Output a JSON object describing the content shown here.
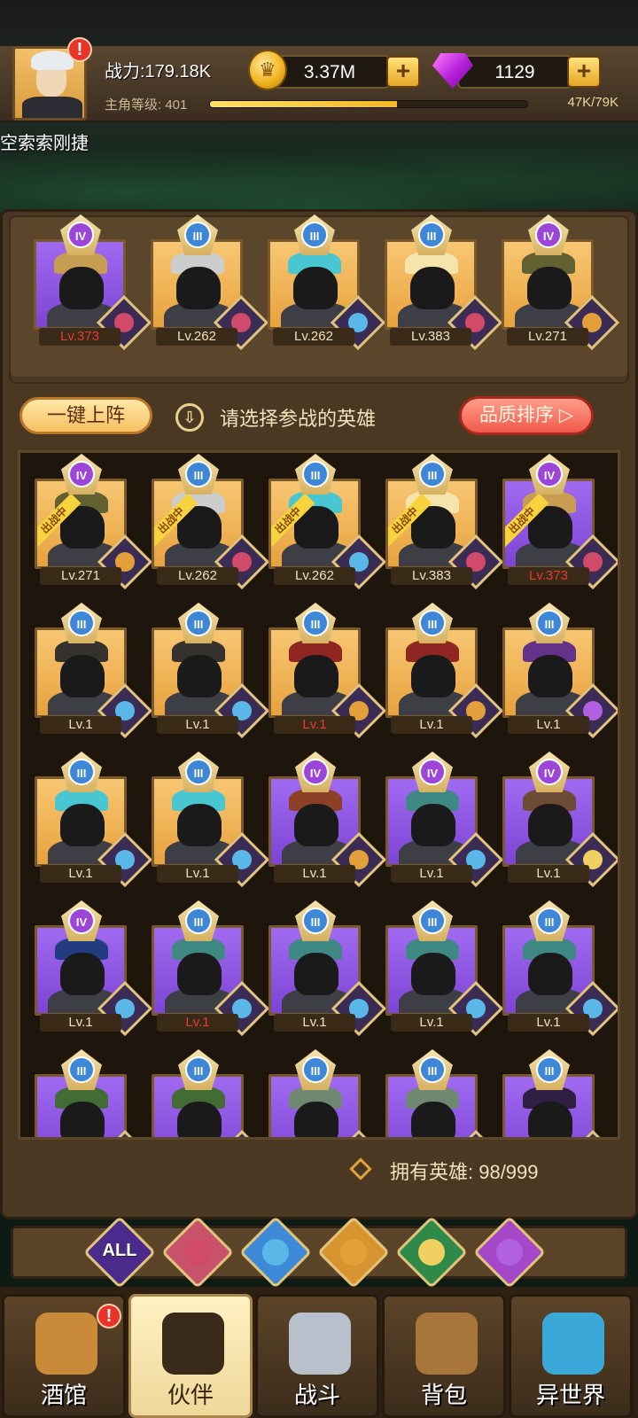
{
  "player": {
    "power": "战力:179.18K",
    "level_label": "主角等级: 401",
    "xp_text": "47K/79K",
    "xp_fraction": 0.59,
    "name": "空索索刚捷",
    "alert_mark": "!"
  },
  "resources": {
    "gold": "3.37M",
    "gems": "1129",
    "plus": "+"
  },
  "team": [
    {
      "rank": "IV",
      "level": "Lv.373",
      "bg": "purple",
      "faction": "crown",
      "level_red": true,
      "acc": "#c9a04a"
    },
    {
      "rank": "III",
      "level": "Lv.262",
      "bg": "gold",
      "faction": "crown",
      "level_red": false,
      "acc": "#c9cdd3"
    },
    {
      "rank": "III",
      "level": "Lv.262",
      "bg": "gold",
      "faction": "elf",
      "level_red": false,
      "acc": "#3ec6d8"
    },
    {
      "rank": "III",
      "level": "Lv.383",
      "bg": "gold",
      "faction": "crown",
      "level_red": false,
      "acc": "#f4e6b0"
    },
    {
      "rank": "IV",
      "level": "Lv.271",
      "bg": "gold",
      "faction": "beast",
      "level_red": false,
      "acc": "#5b5b2e"
    }
  ],
  "actions": {
    "auto_deploy": "一键上阵",
    "hint": "请选择参战的英雄",
    "sort": "品质排序 ▷",
    "download": "⇩"
  },
  "deploy_tag": "出战中",
  "roster": [
    {
      "rank": "IV",
      "level": "Lv.271",
      "bg": "gold",
      "faction": "beast",
      "level_red": false,
      "deployed": true,
      "acc": "#5b5b2e"
    },
    {
      "rank": "III",
      "level": "Lv.262",
      "bg": "gold",
      "faction": "crown",
      "level_red": false,
      "deployed": true,
      "acc": "#c9cdd3"
    },
    {
      "rank": "III",
      "level": "Lv.262",
      "bg": "gold",
      "faction": "elf",
      "level_red": false,
      "deployed": true,
      "acc": "#3ec6d8"
    },
    {
      "rank": "III",
      "level": "Lv.383",
      "bg": "gold",
      "faction": "crown",
      "level_red": false,
      "deployed": true,
      "acc": "#f4e6b0"
    },
    {
      "rank": "IV",
      "level": "Lv.373",
      "bg": "purple",
      "faction": "crown",
      "level_red": true,
      "deployed": true,
      "acc": "#c9a04a"
    },
    {
      "rank": "III",
      "level": "Lv.1",
      "bg": "gold",
      "faction": "elf",
      "level_red": false,
      "deployed": false,
      "acc": "#2a2a2a"
    },
    {
      "rank": "III",
      "level": "Lv.1",
      "bg": "gold",
      "faction": "elf",
      "level_red": false,
      "deployed": false,
      "acc": "#2a2a2a"
    },
    {
      "rank": "III",
      "level": "Lv.1",
      "bg": "gold",
      "faction": "beast",
      "level_red": true,
      "deployed": false,
      "acc": "#8a1e1e"
    },
    {
      "rank": "III",
      "level": "Lv.1",
      "bg": "gold",
      "faction": "beast",
      "level_red": false,
      "deployed": false,
      "acc": "#8a1e1e"
    },
    {
      "rank": "III",
      "level": "Lv.1",
      "bg": "gold",
      "faction": "demon",
      "level_red": false,
      "deployed": false,
      "acc": "#5c2a8a"
    },
    {
      "rank": "III",
      "level": "Lv.1",
      "bg": "gold",
      "faction": "elf",
      "level_red": false,
      "deployed": false,
      "acc": "#3ec6d8"
    },
    {
      "rank": "III",
      "level": "Lv.1",
      "bg": "gold",
      "faction": "elf",
      "level_red": false,
      "deployed": false,
      "acc": "#3ec6d8"
    },
    {
      "rank": "IV",
      "level": "Lv.1",
      "bg": "purple",
      "faction": "beast",
      "level_red": false,
      "deployed": false,
      "acc": "#8a3e1c"
    },
    {
      "rank": "IV",
      "level": "Lv.1",
      "bg": "purple",
      "faction": "elf",
      "level_red": false,
      "deployed": false,
      "acc": "#3a8a7e"
    },
    {
      "rank": "IV",
      "level": "Lv.1",
      "bg": "purple",
      "faction": "nature",
      "level_red": false,
      "deployed": false,
      "acc": "#6b4a2a"
    },
    {
      "rank": "IV",
      "level": "Lv.1",
      "bg": "purple",
      "faction": "elf",
      "level_red": false,
      "deployed": false,
      "acc": "#1c3a7a"
    },
    {
      "rank": "III",
      "level": "Lv.1",
      "bg": "purple",
      "faction": "elf",
      "level_red": true,
      "deployed": false,
      "acc": "#3a8a7e"
    },
    {
      "rank": "III",
      "level": "Lv.1",
      "bg": "purple",
      "faction": "elf",
      "level_red": false,
      "deployed": false,
      "acc": "#3a8a7e"
    },
    {
      "rank": "III",
      "level": "Lv.1",
      "bg": "purple",
      "faction": "elf",
      "level_red": false,
      "deployed": false,
      "acc": "#3a8a7e"
    },
    {
      "rank": "III",
      "level": "Lv.1",
      "bg": "purple",
      "faction": "elf",
      "level_red": false,
      "deployed": false,
      "acc": "#3a8a7e"
    },
    {
      "rank": "III",
      "level": "",
      "bg": "purple",
      "faction": "nature",
      "level_red": false,
      "deployed": false,
      "acc": "#3e6b2a"
    },
    {
      "rank": "III",
      "level": "",
      "bg": "purple",
      "faction": "nature",
      "level_red": false,
      "deployed": false,
      "acc": "#3e6b2a"
    },
    {
      "rank": "III",
      "level": "",
      "bg": "purple",
      "faction": "nature",
      "level_red": false,
      "deployed": false,
      "acc": "#6b8a6a"
    },
    {
      "rank": "III",
      "level": "",
      "bg": "purple",
      "faction": "nature",
      "level_red": false,
      "deployed": false,
      "acc": "#6b8a6a"
    },
    {
      "rank": "III",
      "level": "",
      "bg": "purple",
      "faction": "demon",
      "level_red": false,
      "deployed": false,
      "acc": "#2a1a3a"
    }
  ],
  "owned": "拥有英雄: 98/999",
  "filters": [
    {
      "id": "all",
      "label": "ALL",
      "color": "#4a2a8a"
    },
    {
      "id": "crown",
      "label": "",
      "color": "#c8526a"
    },
    {
      "id": "elf",
      "label": "",
      "color": "#3c8ad8"
    },
    {
      "id": "beast",
      "label": "",
      "color": "#d8942e"
    },
    {
      "id": "nature",
      "label": "",
      "color": "#2f8a4a"
    },
    {
      "id": "demon",
      "label": "",
      "color": "#a448c8"
    }
  ],
  "faction_colors": {
    "crown": "#d14a6a",
    "elf": "#5ab8e8",
    "beast": "#e3a03a",
    "nature": "#f0d060",
    "demon": "#b060e0"
  },
  "nav": [
    {
      "label": "酒馆",
      "icon": "tavern-mug-icon",
      "active": false,
      "color": "#c98a3a",
      "alert": true
    },
    {
      "label": "伙伴",
      "icon": "partner-face-icon",
      "active": true,
      "color": "#3a2a1a",
      "alert": false
    },
    {
      "label": "战斗",
      "icon": "crossed-swords-icon",
      "active": false,
      "color": "#b8c0cc",
      "alert": false
    },
    {
      "label": "背包",
      "icon": "backpack-chest-icon",
      "active": false,
      "color": "#a8763a",
      "alert": false
    },
    {
      "label": "异世界",
      "icon": "portal-icon",
      "active": false,
      "color": "#3aa8d8",
      "alert": false
    }
  ]
}
